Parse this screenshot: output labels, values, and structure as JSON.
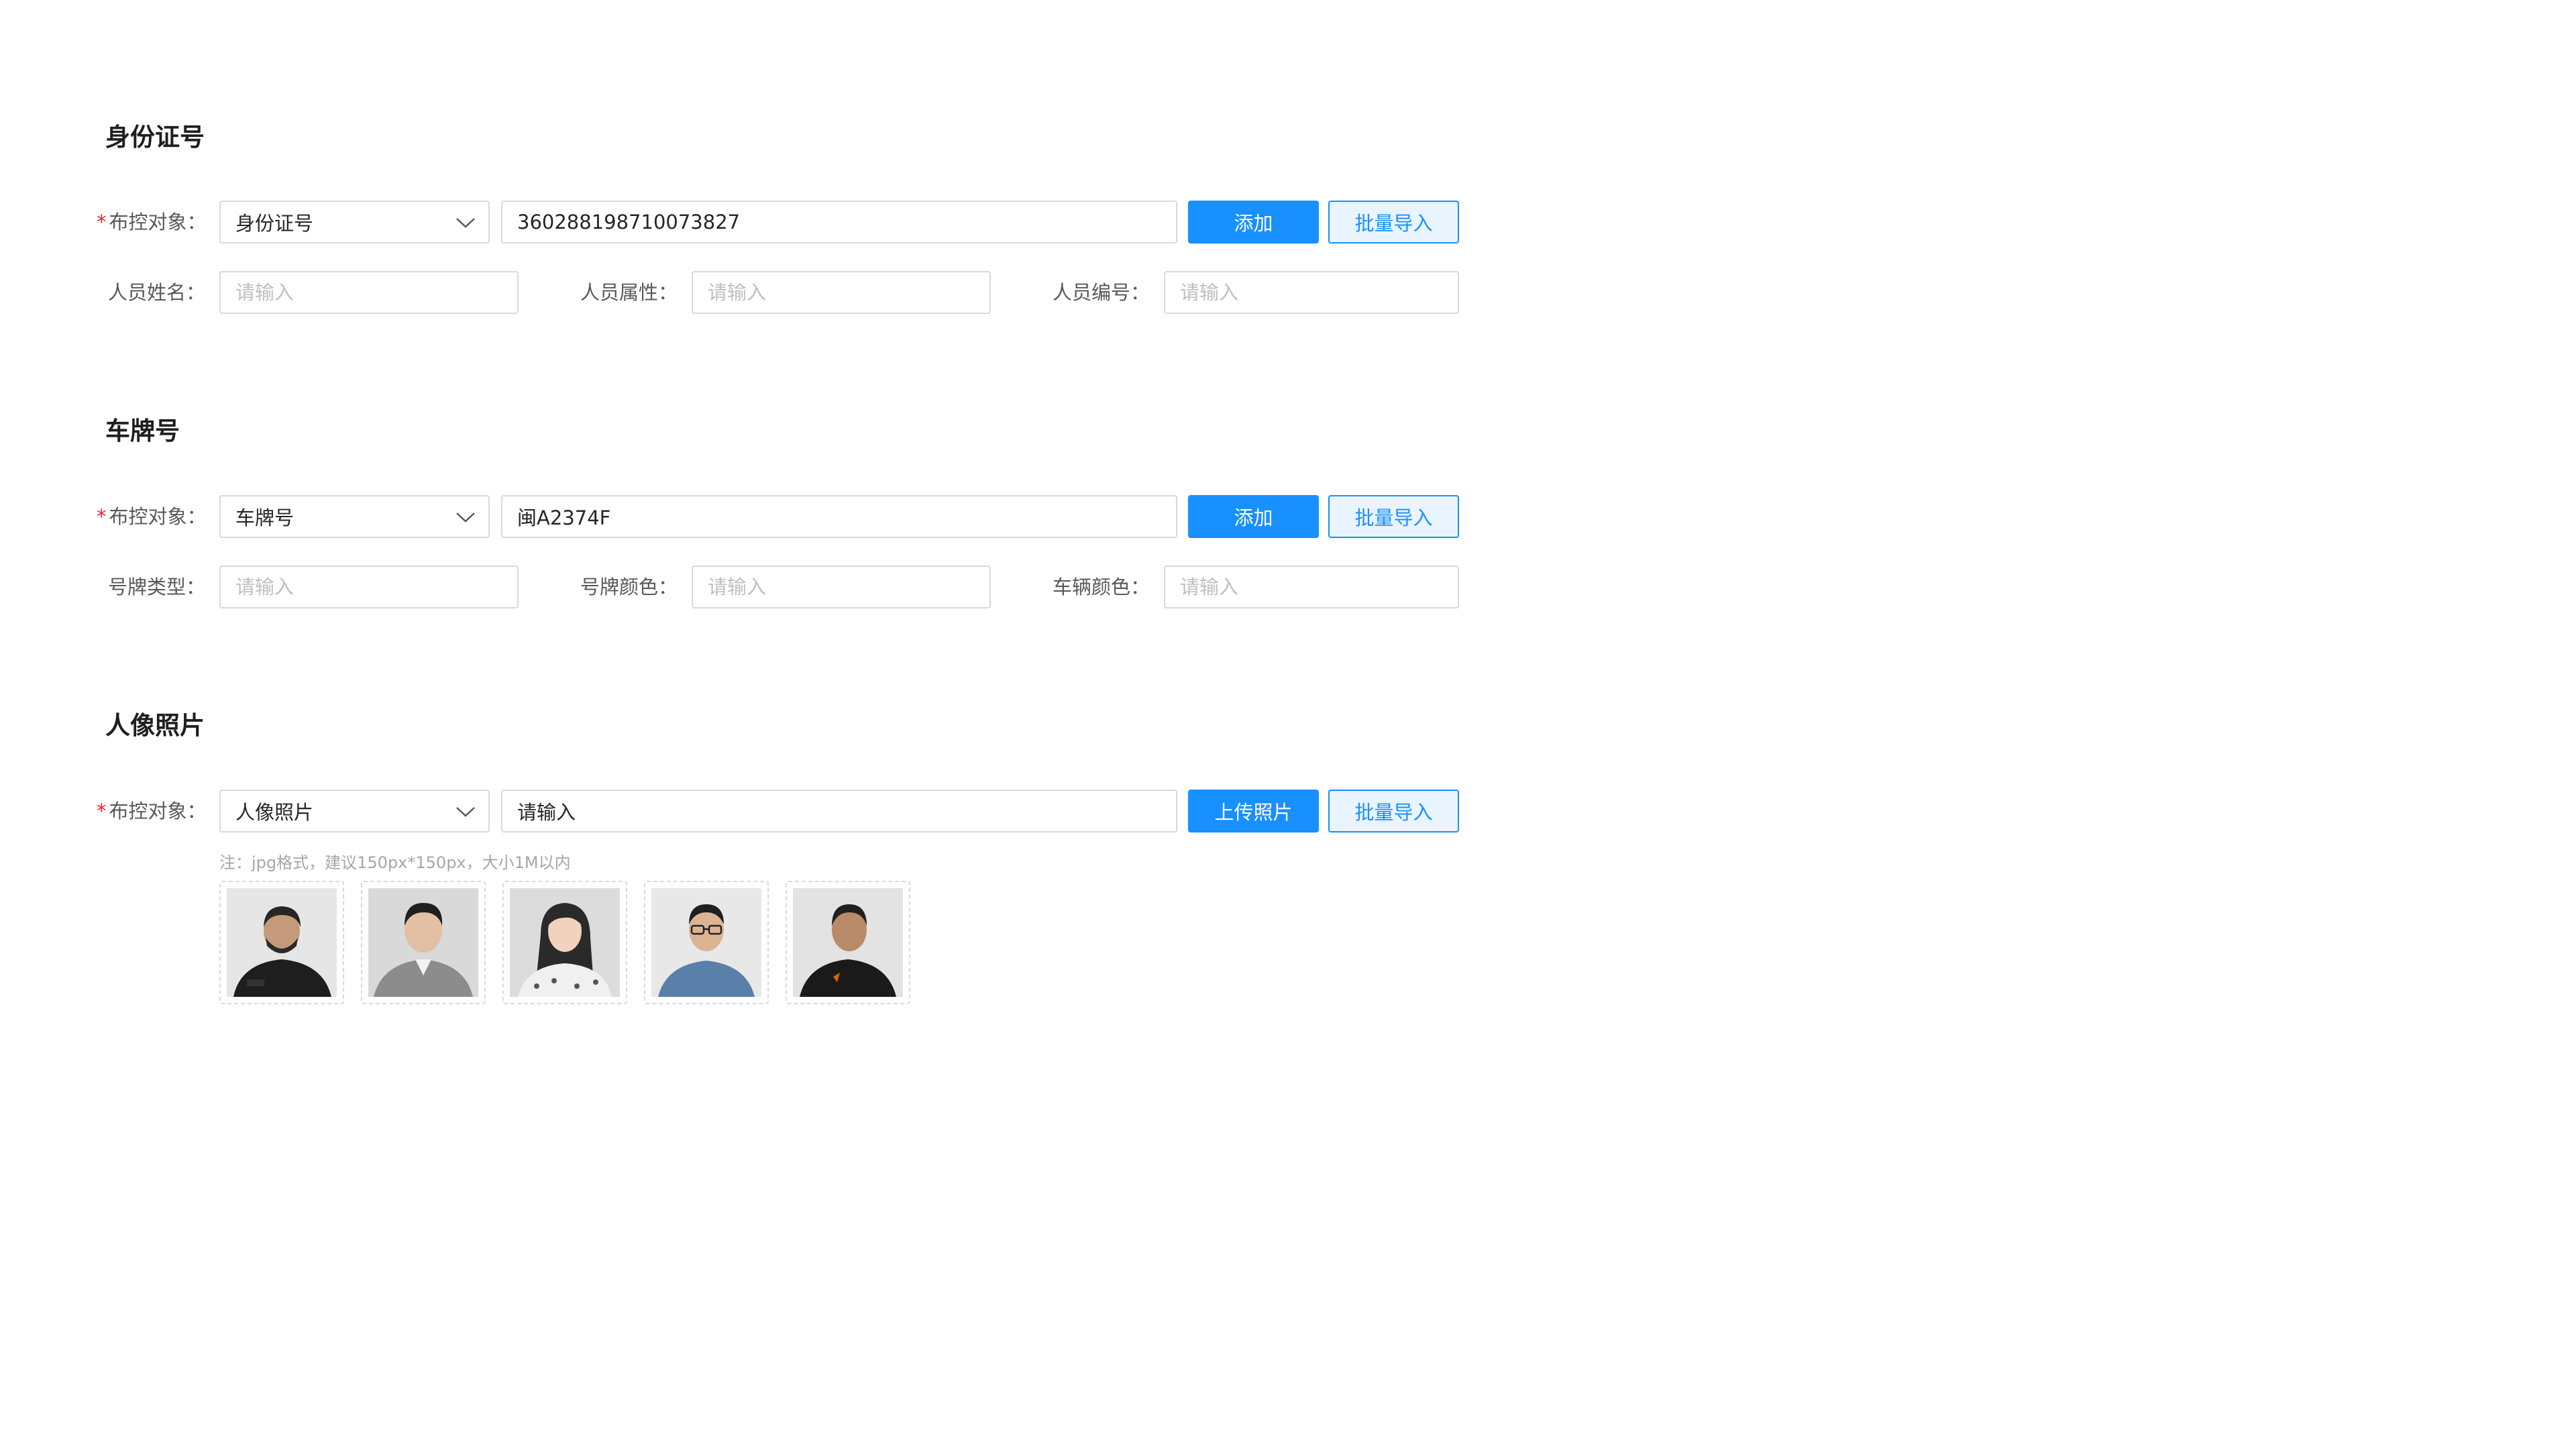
{
  "sections": [
    {
      "title": "身份证号",
      "target_label": "布控对象：",
      "select_value": "身份证号",
      "main_input_value": "360288198710073827",
      "primary_button": "添加",
      "batch_button": "批量导入",
      "fields": [
        {
          "label": "人员姓名：",
          "placeholder": "请输入"
        },
        {
          "label": "人员属性：",
          "placeholder": "请输入"
        },
        {
          "label": "人员编号：",
          "placeholder": "请输入"
        }
      ]
    },
    {
      "title": "车牌号",
      "target_label": "布控对象：",
      "select_value": "车牌号",
      "main_input_value": "闽A2374F",
      "primary_button": "添加",
      "batch_button": "批量导入",
      "fields": [
        {
          "label": "号牌类型：",
          "placeholder": "请输入"
        },
        {
          "label": "号牌颜色：",
          "placeholder": "请输入"
        },
        {
          "label": "车辆颜色：",
          "placeholder": "请输入"
        }
      ]
    },
    {
      "title": "人像照片",
      "target_label": "布控对象：",
      "select_value": "人像照片",
      "main_input_value": "请输入",
      "primary_button": "上传照片",
      "batch_button": "批量导入",
      "note": "注：jpg格式，建议150px*150px，大小1M以内"
    }
  ],
  "required_mark": "*",
  "icons": {
    "select_arrow": "chevron-down-icon"
  },
  "colors": {
    "primary": "#1890ff",
    "required": "#f5222d",
    "border": "#d9d9d9",
    "placeholder": "#bfbfbf"
  }
}
